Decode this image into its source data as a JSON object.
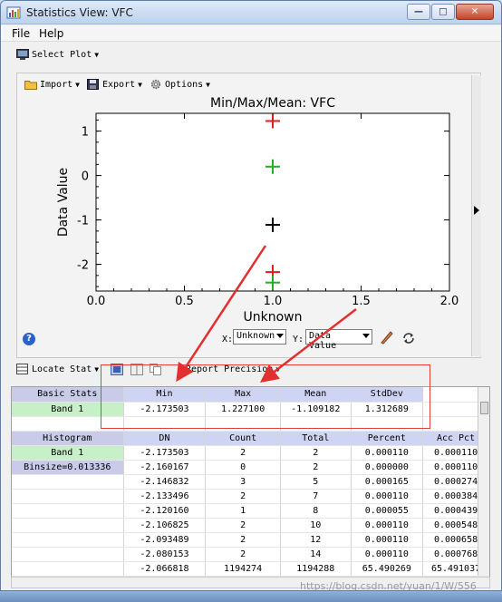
{
  "window": {
    "title": "Statistics View: VFC"
  },
  "menu": [
    "File",
    "Help"
  ],
  "toolbar": {
    "select_plot": "Select Plot"
  },
  "plot_toolbar": {
    "import": "Import",
    "export": "Export",
    "options": "Options"
  },
  "chart_data": {
    "type": "scatter",
    "title": "Min/Max/Mean: VFC",
    "xlabel": "Unknown",
    "ylabel": "Data Value",
    "xlim": [
      0.0,
      2.0
    ],
    "ylim": [
      -2.6,
      1.4
    ],
    "xticks": [
      "0.0",
      "0.5",
      "1.0",
      "1.5",
      "2.0"
    ],
    "yticks": [
      "1",
      "0",
      "-1",
      "-2"
    ],
    "series": [
      {
        "x": [
          1.0,
          1.0
        ],
        "y": [
          1.2271,
          -2.173503
        ],
        "color": "#e02020"
      },
      {
        "x": [
          1.0,
          1.0
        ],
        "y": [
          0.2,
          -2.41
        ],
        "color": "#20b020"
      },
      {
        "x": [
          1.0
        ],
        "y": [
          -1.109182
        ],
        "color": "#000000"
      }
    ]
  },
  "axis_controls": {
    "x_label": "X:",
    "x_value": "Unknown",
    "y_label": "Y:",
    "y_value": "Data Value"
  },
  "stats_toolbar": {
    "locate_stat": "Locate Stat",
    "report_precision": "Report Precision"
  },
  "basic_stats": {
    "header": "Basic Stats",
    "columns": [
      "Min",
      "Max",
      "Mean",
      "StdDev"
    ],
    "rows": [
      {
        "label": "Band 1",
        "values": [
          "-2.173503",
          "1.227100",
          "-1.109182",
          "1.312689"
        ]
      }
    ]
  },
  "histogram": {
    "header": "Histogram",
    "band_label": "Band 1",
    "binsize_label": "Binsize=0.013336",
    "columns": [
      "DN",
      "Count",
      "Total",
      "Percent",
      "Acc Pct"
    ],
    "rows": [
      [
        "-2.173503",
        "2",
        "2",
        "0.000110",
        "0.000110"
      ],
      [
        "-2.160167",
        "0",
        "2",
        "0.000000",
        "0.000110"
      ],
      [
        "-2.146832",
        "3",
        "5",
        "0.000165",
        "0.000274"
      ],
      [
        "-2.133496",
        "2",
        "7",
        "0.000110",
        "0.000384"
      ],
      [
        "-2.120160",
        "1",
        "8",
        "0.000055",
        "0.000439"
      ],
      [
        "-2.106825",
        "2",
        "10",
        "0.000110",
        "0.000548"
      ],
      [
        "-2.093489",
        "2",
        "12",
        "0.000110",
        "0.000658"
      ],
      [
        "-2.080153",
        "2",
        "14",
        "0.000110",
        "0.000768"
      ],
      [
        "-2.066818",
        "1194274",
        "1194288",
        "65.490269",
        "65.491037"
      ]
    ]
  },
  "watermark": "https://blog.csdn.net/yuan/1/W/556"
}
